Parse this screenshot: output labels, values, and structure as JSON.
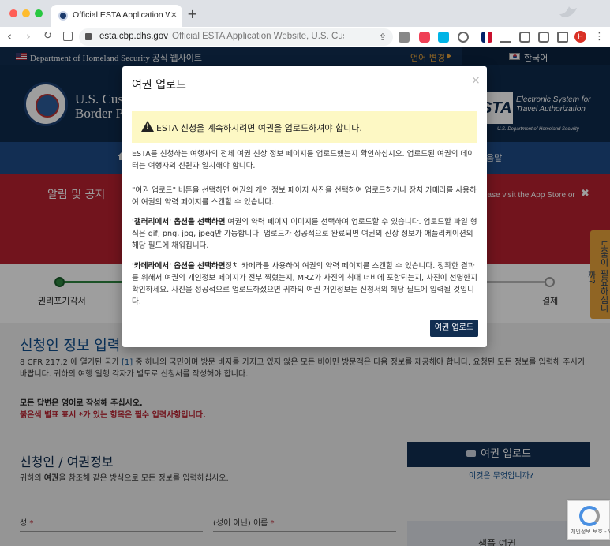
{
  "browser": {
    "tab_title": "Official ESTA Application Website",
    "tab_close": "×",
    "new_tab": "+",
    "url_host": "esta.cbp.dhs.gov",
    "url_title": "Official ESTA Application Website, U.S. Customs",
    "profile_initial": "H",
    "kebab": "⋮"
  },
  "banner": {
    "dhs_text": "Department of Homeland Security 공식 웹사이트",
    "language_change": "언어 변경",
    "current_language": "한국어"
  },
  "header": {
    "agency_line1": "U.S. Cust",
    "agency_line2": "Border P",
    "esta_word": "STA",
    "esta_system": "Electronic System for Travel Authorization",
    "esta_dhs": "U.S. Department of Homeland Security"
  },
  "nav": {
    "help_fragment": "움말"
  },
  "alert": {
    "title": "알림 및 공지",
    "right_text": "ease visit the App Store or",
    "close": "✖"
  },
  "progress": {
    "left_label": "권리포기각서",
    "right_label": "결제"
  },
  "help_tab": "도움이 필요하십니까?",
  "main": {
    "title": "신청인 정보 입력",
    "desc_prefix": "8 CFR 217.2 에 열거된 국가",
    "desc_footnote": "[1]",
    "desc_rest": " 중 하나의 국민이며 방문 비자를 가지고 있지 않은 모든 비이민 방문객은 다음 정보를 제공해야 합니다. 요청된 모든 정보를 입력해 주시기 바랍니다. 귀하의 여행 일행 각자가 별도로 신청서를 작성해야 합니다.",
    "english_note": "모든 답변은 영어로 작성해 주십시오.",
    "required_note": "붉은색 별표 표시 *가 있는 항목은 필수 입력사항입니다.",
    "section_title": "신청인 / 여권정보",
    "section_desc_pre": "귀하의 ",
    "section_desc_bold": "여권",
    "section_desc_post": "을 참조해 같은 방식으로 모든 정보를 입력하십시오.",
    "upload_button": "여권 업로드",
    "what_is_this": "이것은 무엇입니까?",
    "surname_label": "성",
    "given_name_label": "(성이 아닌) 이름",
    "required_star": " *",
    "sample_title": "샘플 여권",
    "recaptcha_text": "개인정보 보호 - 약관"
  },
  "modal": {
    "title": "여권 업로드",
    "close": "×",
    "warning": "ESTA 신청을 계속하시려면 여권을 업로드하셔야 합니다.",
    "p1": "ESTA를 신청하는 여행자의 전체 여권 신상 정보 페이지를 업로드했는지 확인하십시오. 업로드된 여권의 데이터는 여행자의 신원과 일치해야 합니다.",
    "p2": "\"여권 업로드\" 버튼을 선택하면 여권의 개인 정보 페이지 사진을 선택하여 업로드하거나 장치 카메라를 사용하여 여권의 약력 페이지를 스캔할 수 있습니다.",
    "p3_bold": "'갤러리에서' 옵션을 선택하면",
    "p3_rest": " 여권의 약력 페이지 이미지를 선택하여 업로드할 수 있습니다. 업로드할 파일 형식은 gif, png, jpg, jpeg만 가능합니다. 업로드가 성공적으로 완료되면 여권의 신상 정보가 애플리케이션의 해당 필드에 채워집니다.",
    "p4_bold": "'카메라에서' 옵션을 선택하면",
    "p4_rest": "장치 카메라를 사용하여 여권의 약력 페이지를 스캔할 수 있습니다. 정확한 결과를 위해서 여권의 개인정보 페이지가 전부 찍혔는지, MRZ가 사진의 최대 너비에 포함되는지, 사진이 선명한지 확인하세요. 사진을 성공적으로 업로드하셨으면 귀하의 여권 개인정보는 신청서의 해당 필드에 입력될 것입니다.",
    "upload_button": "여권 업로드"
  }
}
